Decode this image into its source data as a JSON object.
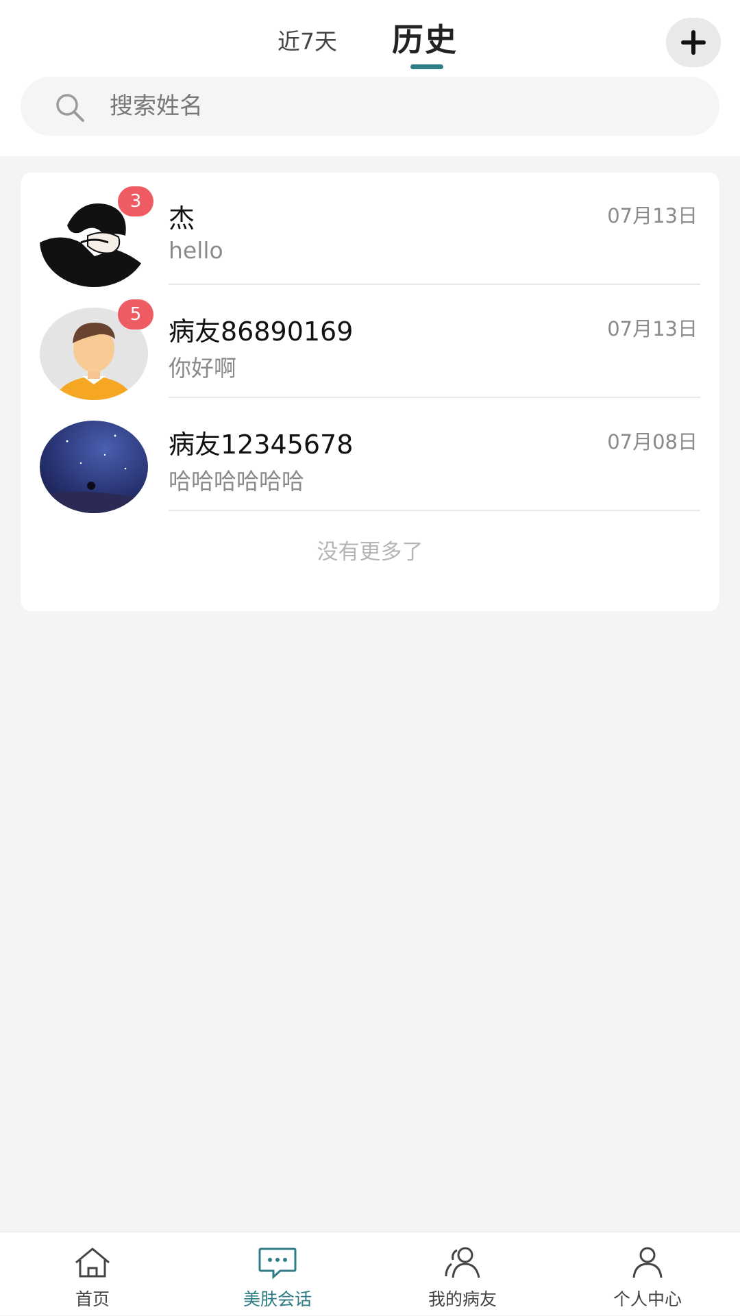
{
  "header": {
    "tabs": [
      {
        "label": "近7天",
        "active": false
      },
      {
        "label": "历史",
        "active": true
      }
    ],
    "add_icon": "plus-icon",
    "accent_color": "#2e7d86"
  },
  "search": {
    "placeholder": "搜索姓名",
    "value": "",
    "icon": "search-icon"
  },
  "conversations": [
    {
      "name": "杰",
      "preview": "hello",
      "date": "07月13日",
      "badge": "3"
    },
    {
      "name": "病友86890169",
      "preview": "你好啊",
      "date": "07月13日",
      "badge": "5"
    },
    {
      "name": "病友12345678",
      "preview": "哈哈哈哈哈哈",
      "date": "07月08日",
      "badge": ""
    }
  ],
  "list_footer": "没有更多了",
  "badge_color": "#ef5b63",
  "bottom_nav": [
    {
      "label": "首页",
      "icon": "home-icon",
      "active": false
    },
    {
      "label": "美肤会话",
      "icon": "chat-bubble-icon",
      "active": true
    },
    {
      "label": "我的病友",
      "icon": "people-icon",
      "active": false
    },
    {
      "label": "个人中心",
      "icon": "person-icon",
      "active": false
    }
  ]
}
